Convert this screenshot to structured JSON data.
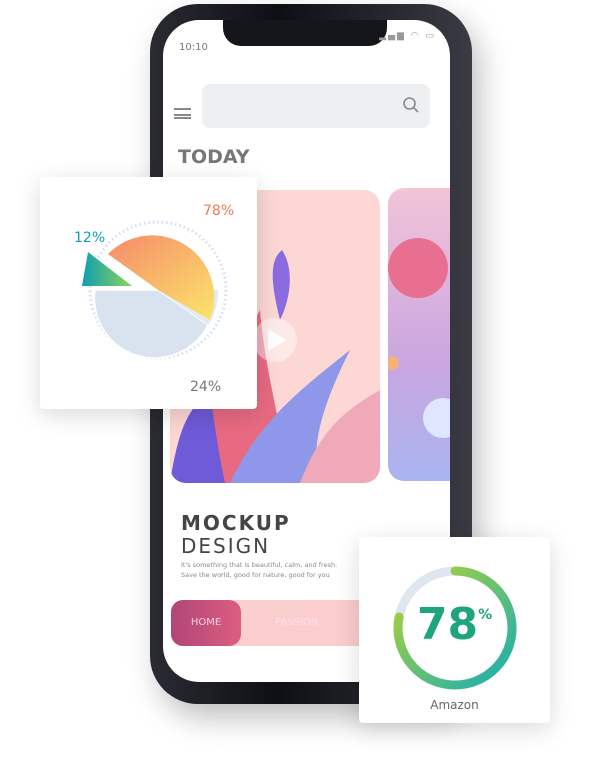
{
  "phone": {
    "status_time": "10:10",
    "search": {
      "placeholder": "",
      "icon": "search-icon"
    },
    "section_title": "TODAY",
    "hero": {
      "title_line1": "MOCKUP",
      "title_line2": "DESIGN",
      "subtitle_line1": "It's something that is beautiful, calm, and fresh.",
      "subtitle_line2": "Save the world, good for nature, good for you"
    },
    "tabs": [
      {
        "label": "HOME",
        "active": true
      },
      {
        "label": "PASSION",
        "active": false
      }
    ]
  },
  "pie_card": {
    "labels": [
      "78%",
      "12%",
      "24%"
    ]
  },
  "chart_data": {
    "type": "pie",
    "slices": [
      {
        "label": "78%",
        "color": "#f7a66a"
      },
      {
        "label": "12%",
        "color": "#1aa9a4"
      },
      {
        "label": "24%",
        "color": "#d8e3ef"
      }
    ]
  },
  "gauge_card": {
    "value": "78",
    "unit": "%",
    "percent": 78,
    "label": "Amazon",
    "colors": {
      "start": "#16aeb4",
      "end": "#b8d430",
      "track": "#dfe6ef"
    }
  }
}
